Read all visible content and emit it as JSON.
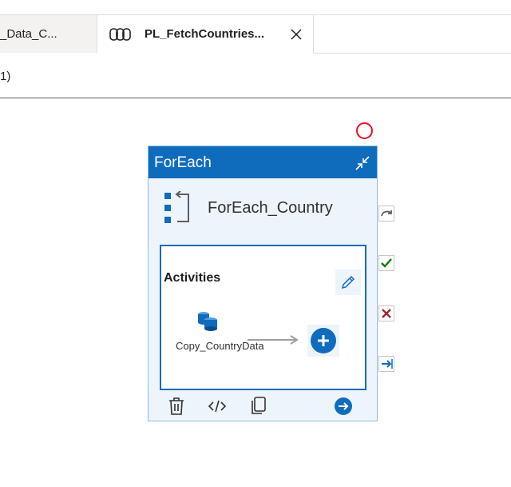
{
  "tabs": [
    {
      "label": "_Data_C...",
      "active": false
    },
    {
      "label": "PL_FetchCountries...",
      "active": true,
      "icon": "pipeline-icon"
    }
  ],
  "subrow": {
    "text": "1)"
  },
  "node": {
    "type_label": "ForEach",
    "name": "ForEach_Country",
    "activities_label": "Activities",
    "activity": {
      "label": "Copy_CountryData",
      "icon": "copy-data-icon"
    },
    "footer_icons": [
      "delete-icon",
      "code-icon",
      "clone-icon",
      "navigate-icon"
    ],
    "colors": {
      "header": "#0f6cbd",
      "accent": "#0f6cbd",
      "body": "#eef4fb",
      "error": "#e81123",
      "success": "#107c10",
      "failure": "#a4262c"
    }
  },
  "side_outputs": [
    "skip-icon",
    "success-icon",
    "failure-icon",
    "completion-icon"
  ]
}
